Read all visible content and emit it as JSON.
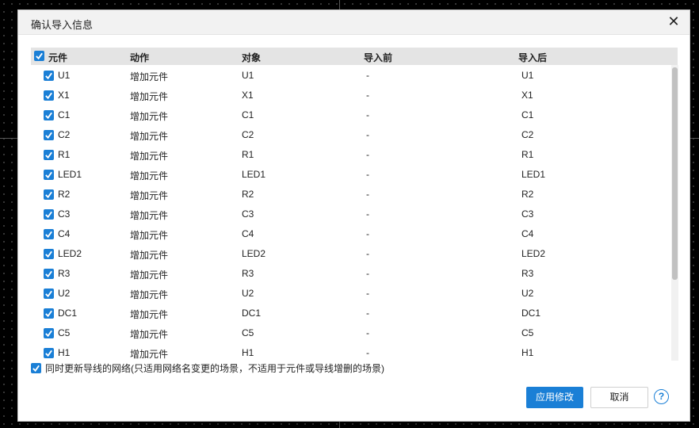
{
  "dialog": {
    "title": "确认导入信息",
    "close_icon": "close-icon"
  },
  "table": {
    "headers": [
      "元件",
      "动作",
      "对象",
      "导入前",
      "导入后"
    ],
    "rows": [
      {
        "component": "U1",
        "action": "增加元件",
        "object": "U1",
        "before": "-",
        "after": "U1",
        "checked": true
      },
      {
        "component": "X1",
        "action": "增加元件",
        "object": "X1",
        "before": "-",
        "after": "X1",
        "checked": true
      },
      {
        "component": "C1",
        "action": "增加元件",
        "object": "C1",
        "before": "-",
        "after": "C1",
        "checked": true
      },
      {
        "component": "C2",
        "action": "增加元件",
        "object": "C2",
        "before": "-",
        "after": "C2",
        "checked": true
      },
      {
        "component": "R1",
        "action": "增加元件",
        "object": "R1",
        "before": "-",
        "after": "R1",
        "checked": true
      },
      {
        "component": "LED1",
        "action": "增加元件",
        "object": "LED1",
        "before": "-",
        "after": "LED1",
        "checked": true
      },
      {
        "component": "R2",
        "action": "增加元件",
        "object": "R2",
        "before": "-",
        "after": "R2",
        "checked": true
      },
      {
        "component": "C3",
        "action": "增加元件",
        "object": "C3",
        "before": "-",
        "after": "C3",
        "checked": true
      },
      {
        "component": "C4",
        "action": "增加元件",
        "object": "C4",
        "before": "-",
        "after": "C4",
        "checked": true
      },
      {
        "component": "LED2",
        "action": "增加元件",
        "object": "LED2",
        "before": "-",
        "after": "LED2",
        "checked": true
      },
      {
        "component": "R3",
        "action": "增加元件",
        "object": "R3",
        "before": "-",
        "after": "R3",
        "checked": true
      },
      {
        "component": "U2",
        "action": "增加元件",
        "object": "U2",
        "before": "-",
        "after": "U2",
        "checked": true
      },
      {
        "component": "DC1",
        "action": "增加元件",
        "object": "DC1",
        "before": "-",
        "after": "DC1",
        "checked": true
      },
      {
        "component": "C5",
        "action": "增加元件",
        "object": "C5",
        "before": "-",
        "after": "C5",
        "checked": true
      },
      {
        "component": "H1",
        "action": "增加元件",
        "object": "H1",
        "before": "-",
        "after": "H1",
        "checked": true
      }
    ]
  },
  "options": {
    "update_nets_label": "同时更新导线的网络(只适用网络名变更的场景，不适用于元件或导线增删的场景)",
    "update_nets_checked": true
  },
  "buttons": {
    "apply": "应用修改",
    "cancel": "取消",
    "help": "?"
  },
  "colors": {
    "accent": "#1a7fd6",
    "header_bg": "#e4e4e4",
    "title_bg": "#f2f2f2"
  }
}
